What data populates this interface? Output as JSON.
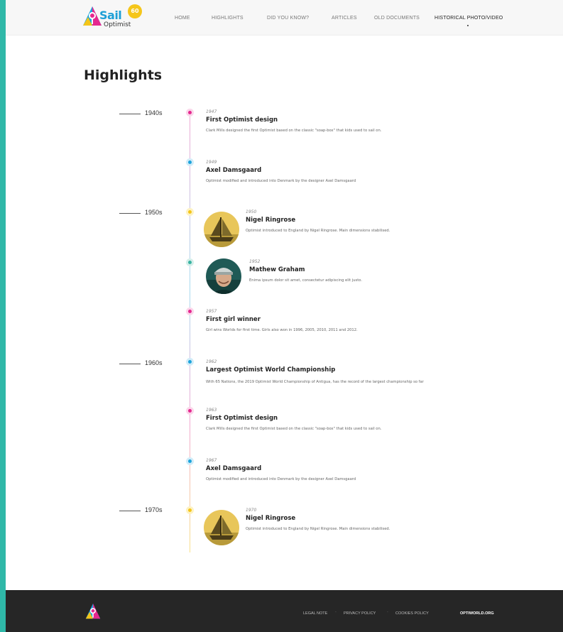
{
  "brand": {
    "name": "Sail",
    "sub": "Optimist",
    "badge": "60"
  },
  "nav": {
    "items": [
      "HOME",
      "HIGHLIGHTS",
      "DID YOU KNOW?",
      "ARTICLES",
      "OLD DOCUMENTS",
      "HISTORICAL PHOTO/VIDEO"
    ],
    "active": "HISTORICAL PHOTO/VIDEO"
  },
  "page": {
    "title": "Highlights"
  },
  "timeline": {
    "decades": [
      "1940s",
      "1950s",
      "1960s",
      "1970s"
    ],
    "entries": [
      {
        "year": "1947",
        "title": "First Optimist design",
        "desc": "Clark Mills designed the first Optimist based on the classic \"soap-box\" that kids used to sail on.",
        "color": "pink"
      },
      {
        "year": "1949",
        "title": "Axel Damsgaard",
        "desc": "Optimist modified and introduced into Denmark by the designer Axel Damsgaard",
        "color": "blue"
      },
      {
        "year": "1950",
        "title": "Nigel Ringrose",
        "desc": "Optimist introduced to England by Nigel Ringrose. Main dimensions stabilised.",
        "color": "yellow",
        "image": "sailboat-photo"
      },
      {
        "year": "1952",
        "title": "Mathew Graham",
        "desc": "Enima ipsum dolor sit amet, consectetur adipiscing elit justo.",
        "color": "teal",
        "image": "portrait-photo"
      },
      {
        "year": "1957",
        "title": "First girl winner",
        "desc": "Girl wins Worlds for first time. Girls also won in 1996, 2005, 2010, 2011 and 2012.",
        "color": "pink"
      },
      {
        "year": "1962",
        "title": "Largest Optimist World Championship",
        "desc": "With 65 Nations, the 2019 Optimist World Championship of Antigua, has the record of the largest championship so far",
        "color": "blue"
      },
      {
        "year": "1963",
        "title": "First Optimist design",
        "desc": "Clark Mills designed the first Optimist based on the classic \"soap-box\" that kids used to sail on.",
        "color": "pink"
      },
      {
        "year": "1967",
        "title": "Axel Damsgaard",
        "desc": "Optimist modified and introduced into Denmark by the designer Axel Damsgaard",
        "color": "blue"
      },
      {
        "year": "1970",
        "title": "Nigel Ringrose",
        "desc": "Optimist introduced to England by Nigel Ringrose. Main dimensions stabilised.",
        "color": "yellow",
        "image": "sailboat-photo"
      }
    ]
  },
  "footer": {
    "links": [
      "LEGAL NOTE",
      "PRIVACY POLICY",
      "COOKIES POLICY"
    ],
    "separator": "·",
    "site": "OPTIWORLD.ORG"
  },
  "colors": {
    "pink": "#e5288f",
    "blue": "#1da4dc",
    "yellow": "#f4c519",
    "teal": "#38b3a2",
    "footer_bg": "#262626",
    "page_border": "#2fb8a8"
  }
}
